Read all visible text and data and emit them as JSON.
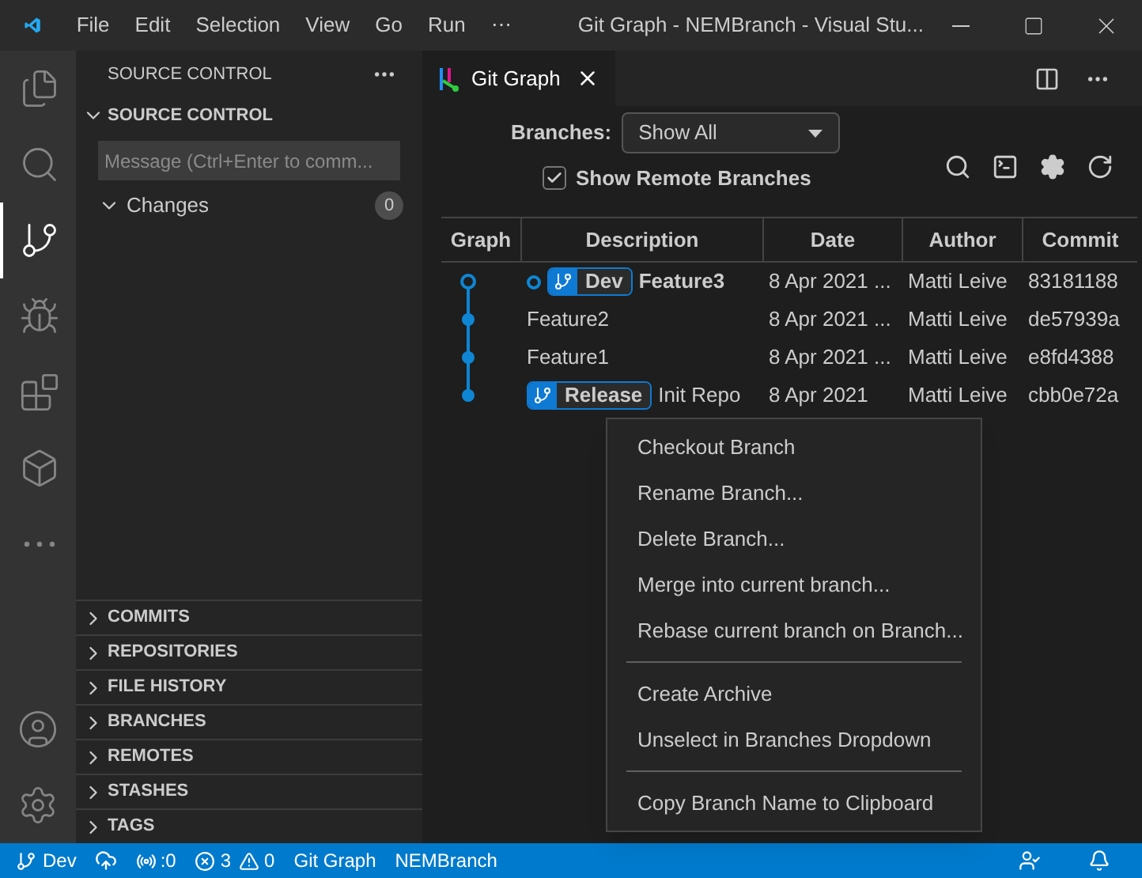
{
  "window": {
    "title": "Git Graph - NEMBranch - Visual Stu...",
    "menu": [
      "File",
      "Edit",
      "Selection",
      "View",
      "Go",
      "Run",
      "⋯"
    ]
  },
  "activity_bar": [
    {
      "kind": "files",
      "selected": false
    },
    {
      "kind": "search",
      "selected": false
    },
    {
      "kind": "scm",
      "selected": true
    },
    {
      "kind": "debug",
      "selected": false
    },
    {
      "kind": "extensions",
      "selected": false
    },
    {
      "kind": "docker",
      "selected": false
    },
    {
      "kind": "more",
      "selected": false
    }
  ],
  "sidebar": {
    "title": "SOURCE CONTROL",
    "section": "SOURCE CONTROL",
    "expanded": true,
    "message_placeholder": "Message (Ctrl+Enter to comm...",
    "changes": {
      "label": "Changes",
      "count": "0",
      "expanded": true
    },
    "panels": [
      {
        "label": "COMMITS",
        "expanded": false
      },
      {
        "label": "REPOSITORIES",
        "expanded": false
      },
      {
        "label": "FILE HISTORY",
        "expanded": false
      },
      {
        "label": "BRANCHES",
        "expanded": false
      },
      {
        "label": "REMOTES",
        "expanded": false
      },
      {
        "label": "STASHES",
        "expanded": false
      },
      {
        "label": "TAGS",
        "expanded": false
      }
    ]
  },
  "tab": {
    "label": "Git Graph",
    "selected": true
  },
  "controls": {
    "branches_label": "Branches:",
    "branches_value": "Show All",
    "remote": {
      "label": "Show Remote Branches",
      "checked": true
    }
  },
  "table": {
    "columns": [
      "Graph",
      "Description",
      "Date",
      "Author",
      "Commit"
    ],
    "rows": [
      {
        "current": true,
        "refs": [
          "Dev"
        ],
        "description": "Feature3",
        "date": "8 Apr 2021 ...",
        "author": "Matti Leive",
        "commit": "83181188"
      },
      {
        "current": false,
        "refs": [],
        "description": "Feature2",
        "date": "8 Apr 2021 ...",
        "author": "Matti Leive",
        "commit": "de57939a"
      },
      {
        "current": false,
        "refs": [],
        "description": "Feature1",
        "date": "8 Apr 2021 ...",
        "author": "Matti Leive",
        "commit": "e8fd4388"
      },
      {
        "current": false,
        "refs": [
          "Release"
        ],
        "description": "Init Repo",
        "date": "8 Apr 2021",
        "author": "Matti Leive",
        "commit": "cbb0e72a"
      }
    ]
  },
  "context_menu": [
    {
      "kind": "item",
      "label": "Checkout Branch"
    },
    {
      "kind": "item",
      "label": "Rename Branch..."
    },
    {
      "kind": "item",
      "label": "Delete Branch..."
    },
    {
      "kind": "item",
      "label": "Merge into current branch..."
    },
    {
      "kind": "item",
      "label": "Rebase current branch on Branch..."
    },
    {
      "kind": "separator"
    },
    {
      "kind": "item",
      "label": "Create Archive"
    },
    {
      "kind": "item",
      "label": "Unselect in Branches Dropdown"
    },
    {
      "kind": "separator"
    },
    {
      "kind": "item",
      "label": "Copy Branch Name to Clipboard"
    }
  ],
  "status_bar": {
    "branch": "Dev",
    "live": ":0",
    "errors": "3",
    "warnings": "0",
    "items": [
      "Git Graph",
      "NEMBranch"
    ]
  }
}
